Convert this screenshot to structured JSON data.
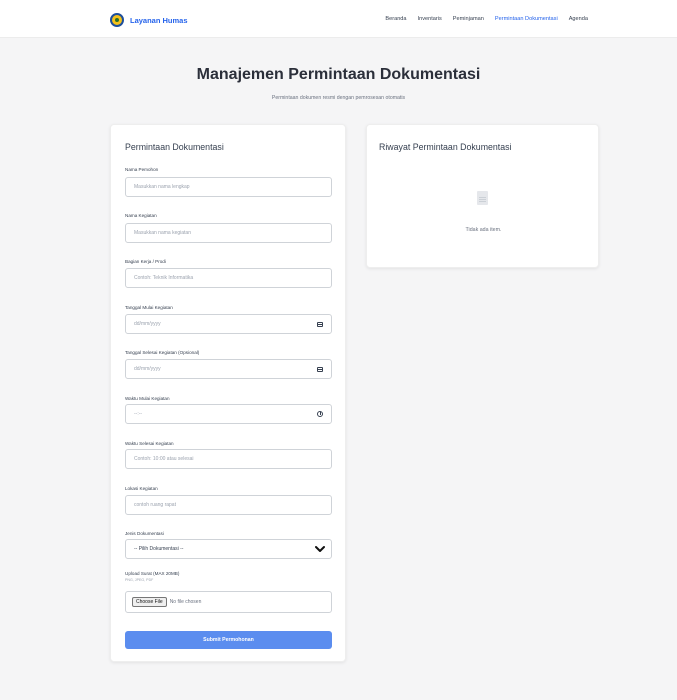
{
  "navbar": {
    "brand": "Layanan Humas",
    "links": [
      "Beranda",
      "Inventaris",
      "Peminjaman",
      "Permintaan Dokumentasi",
      "Agenda"
    ],
    "active_index": 3
  },
  "header": {
    "title": "Manajemen Permintaan Dokumentasi",
    "subtitle": "Permintaan dokumen resmi dengan pemrosesan otomatis"
  },
  "form": {
    "title": "Permintaan Dokumentasi",
    "nama_pemohon": {
      "label": "Nama Pemohon",
      "placeholder": "Masukkan nama lengkap"
    },
    "nama_kegiatan": {
      "label": "Nama Kegiatan",
      "placeholder": "Masukkan nama kegiatan"
    },
    "bagian_kerja": {
      "label": "Bagian Kerja / Prodi",
      "placeholder": "Contoh: Teknik Informatika"
    },
    "tanggal_mulai": {
      "label": "Tanggal Mulai Kegiatan",
      "placeholder": "dd/mm/yyyy"
    },
    "tanggal_selesai": {
      "label": "Tanggal Selesai Kegiatan (Opsional)",
      "placeholder": "dd/mm/yyyy"
    },
    "waktu_mulai": {
      "label": "Waktu Mulai Kegiatan",
      "placeholder": "--:--"
    },
    "waktu_selesai": {
      "label": "Waktu Selesai Kegiatan",
      "placeholder": "Contoh: 10:00 atau selesai"
    },
    "lokasi": {
      "label": "Lokasi Kegiatan",
      "placeholder": "contoh ruang rapat"
    },
    "jenis": {
      "label": "Jenis Dokumentasi",
      "selected": "-- Pilih Dokumentasi --"
    },
    "upload": {
      "label": "Upload Surat (MAX 20MB)",
      "sub": "PNG, JPEG, PDF",
      "button": "Choose File",
      "status": "No file chosen"
    },
    "submit": "Submit Permohonan"
  },
  "history": {
    "title": "Riwayat Permintaan Dokumentasi",
    "empty": "Tidak ada item."
  },
  "colors": {
    "accent": "#2563eb",
    "submit": "#5b8def",
    "background": "#f5f5f6"
  }
}
